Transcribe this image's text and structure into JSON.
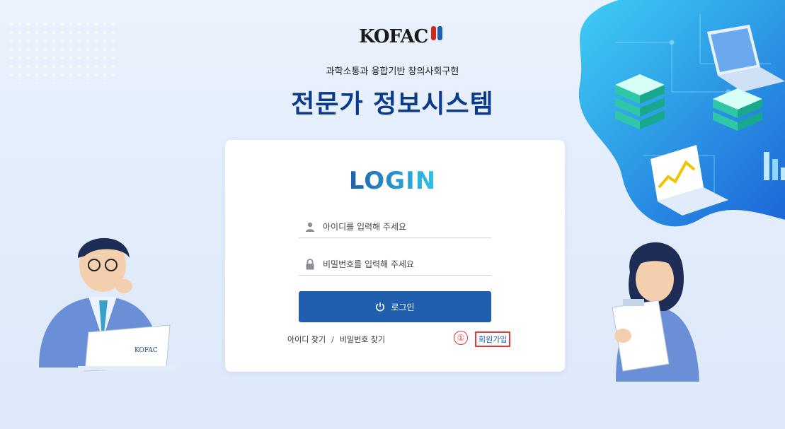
{
  "header": {
    "logo_text": "KOFAC",
    "subtitle": "과학소통과 융합기반 창의사회구현",
    "title": "전문가 정보시스템"
  },
  "login": {
    "title": "LOGIN",
    "id_placeholder": "아이디를 입력해 주세요",
    "pw_placeholder": "비밀번호를 입력해 주세요",
    "button_label": "로그인",
    "find_id": "아이디 찾기",
    "separator": "/",
    "find_pw": "비밀번호 찾기",
    "signup": "회원가입",
    "callout_number": "①"
  },
  "illustration": {
    "laptop_logo": "KOFAC"
  },
  "colors": {
    "title": "#0b3a8c",
    "button": "#1f5fad",
    "highlight": "#e53935",
    "login_gradient_start": "#1f5fad",
    "login_gradient_end": "#31c3e8"
  }
}
